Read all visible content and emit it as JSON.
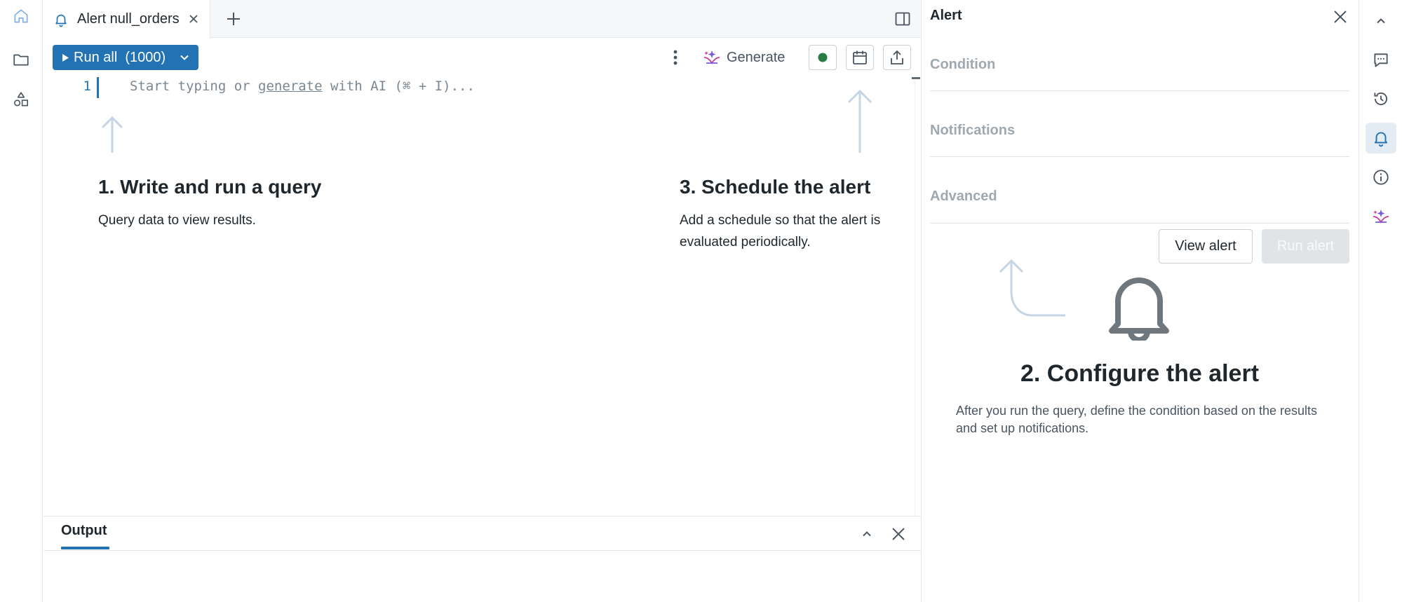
{
  "tab": {
    "title": "Alert null_orders",
    "icon": "bell-icon"
  },
  "toolbar": {
    "run_all_label": "Run all",
    "run_all_limit": "(1000)",
    "generate_label": "Generate",
    "status_color": "#277c43"
  },
  "editor": {
    "line_number": "1",
    "placeholder_pre": "Start typing or ",
    "placeholder_link": "generate",
    "placeholder_post": " with AI (⌘ + I)..."
  },
  "hints": {
    "step1_title": "1. Write and run a query",
    "step1_desc": "Query data to view results.",
    "step3_title": "3. Schedule the alert",
    "step3_desc": "Add a schedule so that the alert is evaluated periodically."
  },
  "output": {
    "tab_label": "Output"
  },
  "alert_panel": {
    "title": "Alert",
    "sections": [
      "Condition",
      "Notifications",
      "Advanced"
    ],
    "view_alert_label": "View alert",
    "run_alert_label": "Run alert",
    "configure_title": "2. Configure the alert",
    "configure_desc": "After you run the query, define the condition based on the results and set up notifications."
  },
  "colors": {
    "accent": "#2272b4",
    "active_rail_bg": "#e3ecf5"
  }
}
